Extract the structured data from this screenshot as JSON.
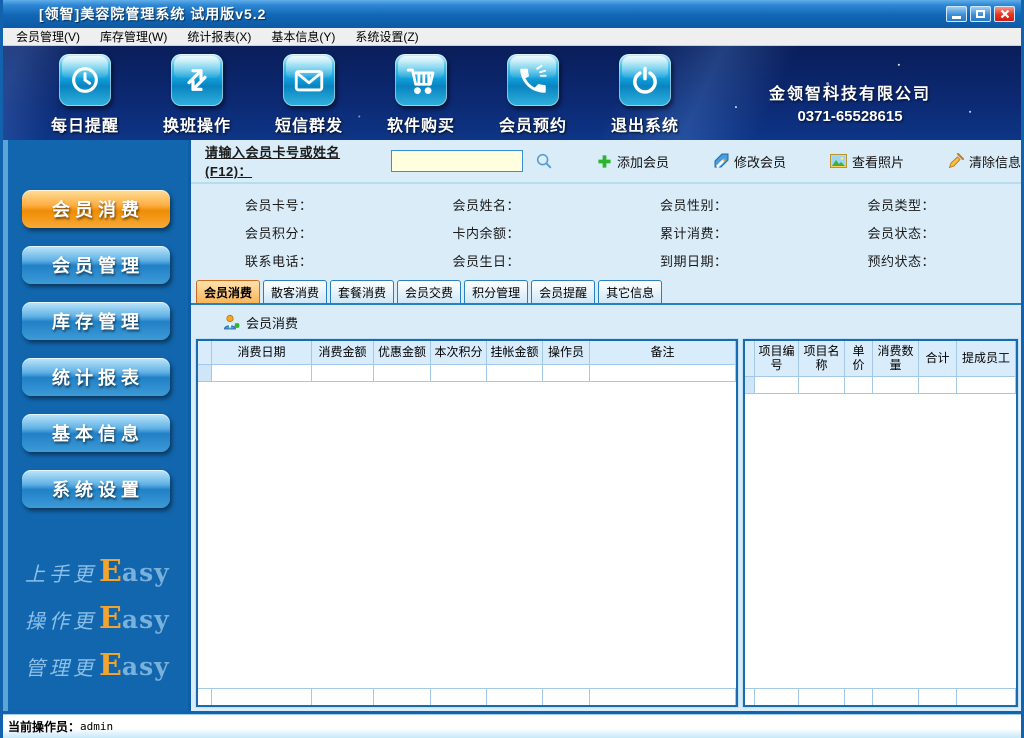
{
  "window": {
    "title": "[领智]美容院管理系统 试用版v5.2"
  },
  "menu": {
    "items": [
      "会员管理(V)",
      "库存管理(W)",
      "统计报表(X)",
      "基本信息(Y)",
      "系统设置(Z)"
    ]
  },
  "toolbar": {
    "items": [
      {
        "label": "每日提醒",
        "icon": "clock-icon"
      },
      {
        "label": "换班操作",
        "icon": "swap-arrows-icon"
      },
      {
        "label": "短信群发",
        "icon": "envelope-icon"
      },
      {
        "label": "软件购买",
        "icon": "cart-icon"
      },
      {
        "label": "会员预约",
        "icon": "phone-icon"
      },
      {
        "label": "退出系统",
        "icon": "power-icon"
      }
    ],
    "company_name": "金领智科技有限公司",
    "company_phone": "0371-65528615"
  },
  "search": {
    "label": "请输入会员卡号或姓名(F12)：",
    "value": ""
  },
  "actions": {
    "add": "添加会员",
    "edit": "修改会员",
    "photo": "查看照片",
    "clear": "清除信息"
  },
  "member_info": {
    "labels": [
      "会员卡号：",
      "会员姓名：",
      "会员性别：",
      "会员类型：",
      "会员积分：",
      "卡内余额：",
      "累计消费：",
      "会员状态：",
      "联系电话：",
      "会员生日：",
      "到期日期：",
      "预约状态："
    ]
  },
  "sidebar": {
    "items": [
      {
        "label": "会员消费",
        "active": true
      },
      {
        "label": "会员管理"
      },
      {
        "label": "库存管理"
      },
      {
        "label": "统计报表"
      },
      {
        "label": "基本信息"
      },
      {
        "label": "系统设置"
      }
    ],
    "slogans": [
      {
        "prefix": "上手更",
        "e": "E",
        "rest": "asy"
      },
      {
        "prefix": "操作更",
        "e": "E",
        "rest": "asy"
      },
      {
        "prefix": "管理更",
        "e": "E",
        "rest": "asy"
      }
    ]
  },
  "tabs": [
    "会员消费",
    "散客消费",
    "套餐消费",
    "会员交费",
    "积分管理",
    "会员提醒",
    "其它信息"
  ],
  "content": {
    "consume_button": "会员消费"
  },
  "left_table": {
    "headers": [
      "消费日期",
      "消费金额",
      "优惠金额",
      "本次积分",
      "挂帐金额",
      "操作员",
      "备注"
    ]
  },
  "right_table": {
    "headers": [
      "项目编号",
      "项目名称",
      "单价",
      "消费数量",
      "合计",
      "提成员工"
    ]
  },
  "statusbar": {
    "label": "当前操作员：",
    "operator": "admin"
  },
  "colors": {
    "titlebar": "#1266b4",
    "accent_orange": "#f79422",
    "panel_bg": "#d9ecf8",
    "toolbar_bg": "#0c2a74"
  }
}
